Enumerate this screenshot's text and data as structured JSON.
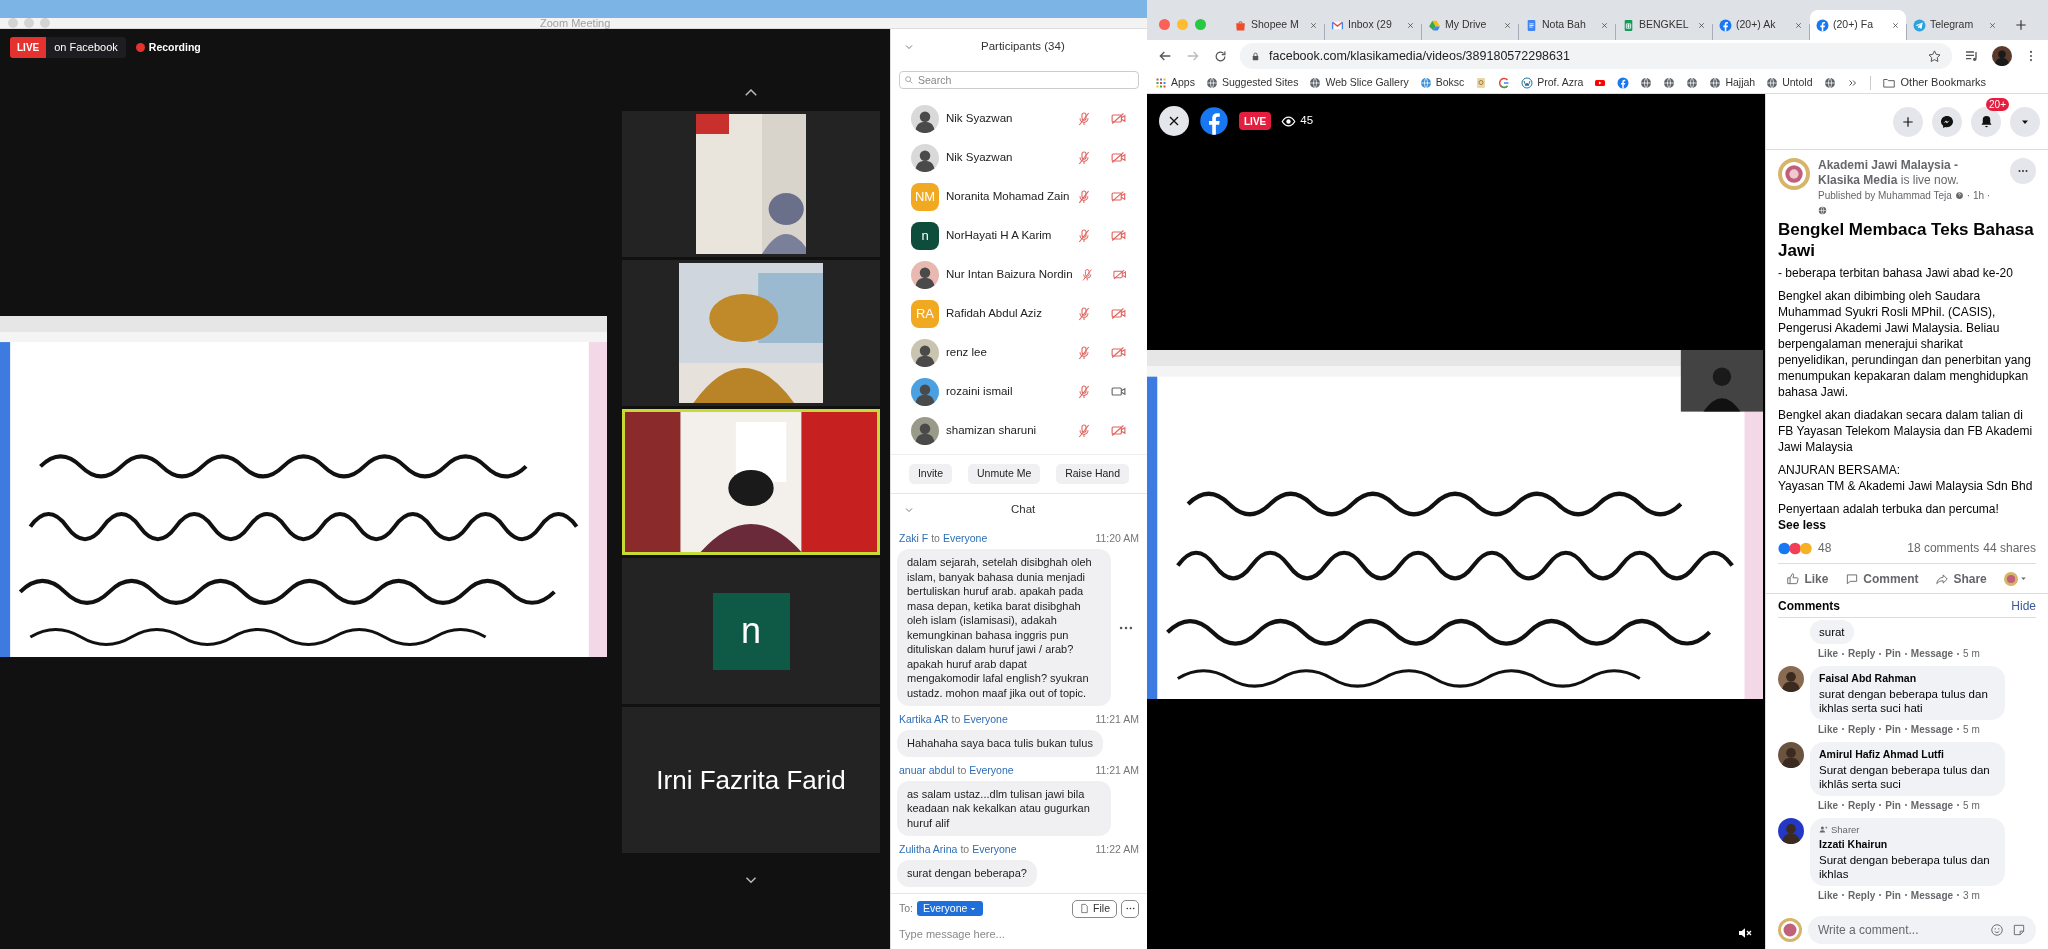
{
  "zoom": {
    "title": "Zoom Meeting",
    "live_badge": "LIVE",
    "live_target": "on Facebook",
    "recording": "Recording",
    "tiles": [
      {
        "kind": "video",
        "speaking": false
      },
      {
        "kind": "video",
        "speaking": false
      },
      {
        "kind": "video",
        "speaking": true
      },
      {
        "kind": "avatar",
        "initial": "n",
        "color": "#0e5a46",
        "speaking": false
      },
      {
        "kind": "name",
        "name": "Irni Fazrita Farid",
        "speaking": false
      }
    ],
    "participants": {
      "title": "Participants (34)",
      "search_placeholder": "Search",
      "rows": [
        {
          "name": "Nik Syazwan",
          "muted": true,
          "video_on": false
        },
        {
          "name": "Nik Syazwan",
          "muted": true,
          "video_on": false
        },
        {
          "name": "Noranita Mohamad Zain",
          "avatar": {
            "kind": "initials",
            "initials": "NM",
            "color": "#f2a922"
          },
          "muted": true,
          "video_on": false
        },
        {
          "name": "NorHayati H A Karim",
          "avatar": {
            "kind": "initials",
            "initials": "n",
            "color": "#0e4d3c"
          },
          "muted": true,
          "video_on": false
        },
        {
          "name": "Nur Intan Baizura Nordin",
          "muted": true,
          "video_on": false
        },
        {
          "name": "Rafidah Abdul Aziz",
          "avatar": {
            "kind": "initials",
            "initials": "RA",
            "color": "#f2a922"
          },
          "muted": true,
          "video_on": false
        },
        {
          "name": "renz lee",
          "muted": true,
          "video_on": false
        },
        {
          "name": "rozaini ismail",
          "muted": true,
          "video_on": true
        },
        {
          "name": "shamizan sharuni",
          "muted": true,
          "video_on": false
        }
      ],
      "buttons": [
        "Invite",
        "Unmute Me",
        "Raise Hand"
      ]
    },
    "chat": {
      "title": "Chat",
      "messages": [
        {
          "sender": "Zaki F",
          "connector": "to",
          "recipient": "Everyone",
          "time": "11:20 AM",
          "text": "dalam sejarah, setelah disibghah oleh islam, banyak bahasa dunia menjadi bertuliskan huruf arab. apakah pada masa depan, ketika barat disibghah oleh islam (islamisasi), adakah kemungkinan bahasa inggris pun dituliskan dalam huruf jawi / arab? apakah huruf arab dapat mengakomodir lafal english? syukran ustadz. mohon maaf jika out of topic.",
          "hovered": true
        },
        {
          "sender": "Kartika AR",
          "connector": "to",
          "recipient": "Everyone",
          "time": "11:21 AM",
          "text": "Hahahaha saya baca tulis bukan tulus",
          "hovered": false
        },
        {
          "sender": "anuar abdul",
          "connector": "to",
          "recipient": "Everyone",
          "time": "11:21 AM",
          "text": "as salam ustaz...dlm tulisan jawi bila keadaan nak kekalkan atau gugurkan huruf alif",
          "hovered": false
        },
        {
          "sender": "Zulitha Arina",
          "connector": "to",
          "recipient": "Everyone",
          "time": "11:22 AM",
          "text": "surat dengan beberapa?",
          "hovered": false
        }
      ],
      "to_label": "To:",
      "recipient": "Everyone",
      "file_button": "File",
      "placeholder": "Type message here..."
    }
  },
  "browser": {
    "tabs": [
      {
        "title": "Shopee M",
        "kind": "shopee",
        "selected": false
      },
      {
        "title": "Inbox (29",
        "kind": "gmail",
        "selected": false
      },
      {
        "title": "My Drive",
        "kind": "drive",
        "selected": false
      },
      {
        "title": "Nota Bah",
        "kind": "docs",
        "selected": false
      },
      {
        "title": "BENGKEL",
        "kind": "sheets",
        "selected": false
      },
      {
        "title": "(20+) Ak",
        "kind": "facebook",
        "selected": false
      },
      {
        "title": "(20+) Fa",
        "kind": "facebook",
        "selected": true
      },
      {
        "title": "Telegram",
        "kind": "telegram",
        "selected": false
      }
    ],
    "url": "facebook.com/klasikamedia/videos/389180572298631",
    "bookmarks": [
      {
        "label": "Apps",
        "kind": "grid"
      },
      {
        "label": "Suggested Sites",
        "kind": "globe"
      },
      {
        "label": "Web Slice Gallery",
        "kind": "globe"
      },
      {
        "label": "Boksc",
        "kind": "web"
      },
      {
        "kind": "tan"
      },
      {
        "kind": "google"
      },
      {
        "label": "Prof. Azra",
        "kind": "wordpress"
      },
      {
        "kind": "youtube"
      },
      {
        "kind": "facebook"
      },
      {
        "kind": "globe"
      },
      {
        "kind": "globe"
      },
      {
        "kind": "globe"
      },
      {
        "label": "Hajjah",
        "kind": "globe"
      },
      {
        "label": "Untold",
        "kind": "globe"
      },
      {
        "kind": "globe"
      }
    ],
    "other_bookmarks": "Other Bookmarks"
  },
  "facebook": {
    "video": {
      "live_badge": "LIVE",
      "viewers": "45"
    },
    "notifications": "20+",
    "post": {
      "page": "**Akademi Jawi Malaysia - Klasika Media** is live now.",
      "published_by": "Published by Muhammad Teja",
      "meta": "· 1h ·",
      "title": "Bengkel Membaca Teks Bahasa Jawi",
      "paragraphs": [
        [
          "- beberapa terbitan bahasa Jawi abad ke-20"
        ],
        [
          "Bengkel akan dibimbing oleh Saudara Muhammad Syukri Rosli MPhil. (CASIS), Pengerusi Akademi Jawi Malaysia. Beliau berpengalaman menerajui sharikat penyelidikan, perundingan dan penerbitan yang menumpukan kepakaran dalam menghidupkan bahasa Jawi."
        ],
        [
          "Bengkel akan diadakan secara dalam talian di FB Yayasan Telekom Malaysia dan FB Akademi Jawi Malaysia"
        ],
        [
          "ANJURAN BERSAMA:",
          "Yayasan TM & Akademi Jawi Malaysia Sdn Bhd"
        ],
        [
          "Penyertaan adalah terbuka dan percuma!"
        ]
      ],
      "see_less": "See less",
      "reactions": "48",
      "comments_count": "18 comments",
      "shares_count": "44 shares",
      "actions": [
        "Like",
        "Comment",
        "Share"
      ]
    },
    "comments": {
      "title": "Comments",
      "hide": "Hide",
      "items": [
        {
          "text": "surat",
          "actions": [
            "Like",
            "Reply",
            "Pin",
            "Message"
          ],
          "time": "5 m"
        },
        {
          "author": "Faisal Abd Rahman",
          "text": "surat dengan beberapa tulus dan ikhlas serta suci hati",
          "actions": [
            "Like",
            "Reply",
            "Pin",
            "Message"
          ],
          "time": "5 m"
        },
        {
          "author": "Amirul Hafiz Ahmad Lutfi",
          "text": "Surat dengan beberapa tulus dan ikhlās serta suci",
          "actions": [
            "Like",
            "Reply",
            "Pin",
            "Message"
          ],
          "time": "5 m"
        },
        {
          "badge": "Sharer",
          "author": "Izzati Khairun",
          "text": "Surat dengan beberapa tulus dan ikhlas",
          "actions": [
            "Like",
            "Reply",
            "Pin",
            "Message"
          ],
          "time": "3 m"
        }
      ],
      "placeholder": "Write a comment..."
    }
  }
}
